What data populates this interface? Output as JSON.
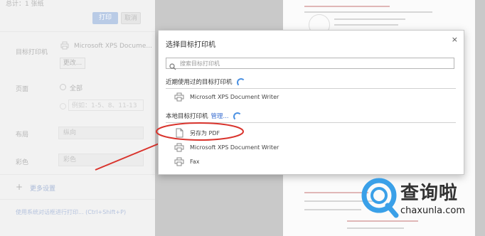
{
  "left_panel": {
    "header_text": "总计：1 张纸",
    "print_button": "打印",
    "cancel_button": "取消",
    "target_label": "目标打印机",
    "target_value": "Microsoft XPS Docume...",
    "change_button": "更改...",
    "pages_label": "页面",
    "pages_all": "全部",
    "pages_placeholder": "例如：1-5、8、11-13",
    "layout_label": "布局",
    "layout_value": "纵向",
    "color_label": "彩色",
    "color_value": "彩色",
    "more_settings": "更多设置",
    "system_dialog": "使用系统对话框进行打印... (Ctrl+Shift+P)"
  },
  "dialog": {
    "title": "选择目标打印机",
    "close": "×",
    "search_placeholder": "搜索目标打印机",
    "recent_header": "近期使用过的目标打印机",
    "recent_items": [
      "Microsoft XPS Document Writer"
    ],
    "local_header": "本地目标打印机",
    "manage_link": "管理...",
    "local_items": [
      "另存为 PDF",
      "Microsoft XPS Document Writer",
      "Fax"
    ]
  },
  "watermark": {
    "text": "查询啦",
    "url": "chaxunla.com"
  },
  "colors": {
    "accent": "#4a90e2",
    "annotation": "#d9332c"
  }
}
